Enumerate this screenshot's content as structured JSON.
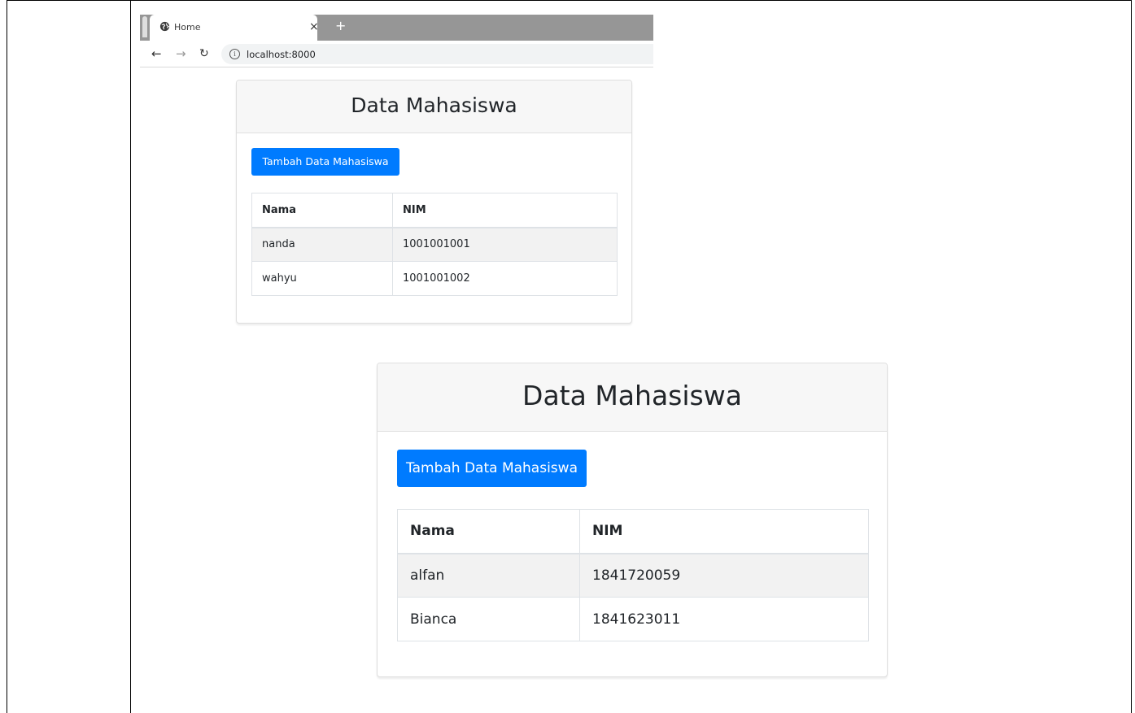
{
  "browser": {
    "tab_title": "Home",
    "tab_close": "×",
    "new_tab": "+",
    "url": "localhost:8000",
    "icons": [
      "globe-icon",
      "close-icon",
      "plus-icon",
      "back-arrow-icon",
      "forward-arrow-icon",
      "reload-icon",
      "info-icon"
    ]
  },
  "cards": [
    {
      "title": "Data Mahasiswa",
      "button_label": "Tambah Data Mahasiswa",
      "headers": [
        "Nama",
        "NIM"
      ],
      "rows": [
        [
          "nanda",
          "1001001001"
        ],
        [
          "wahyu",
          "1001001002"
        ]
      ]
    },
    {
      "title": "Data Mahasiswa",
      "button_label": "Tambah Data Mahasiswa",
      "headers": [
        "Nama",
        "NIM"
      ],
      "rows": [
        [
          "alfan",
          "1841720059"
        ],
        [
          "Bianca",
          "1841623011"
        ]
      ]
    }
  ],
  "colors": {
    "primary": "#007bff",
    "header_bg": "#f7f7f7",
    "striped_row": "#f2f2f2",
    "tabbar": "#969696"
  }
}
